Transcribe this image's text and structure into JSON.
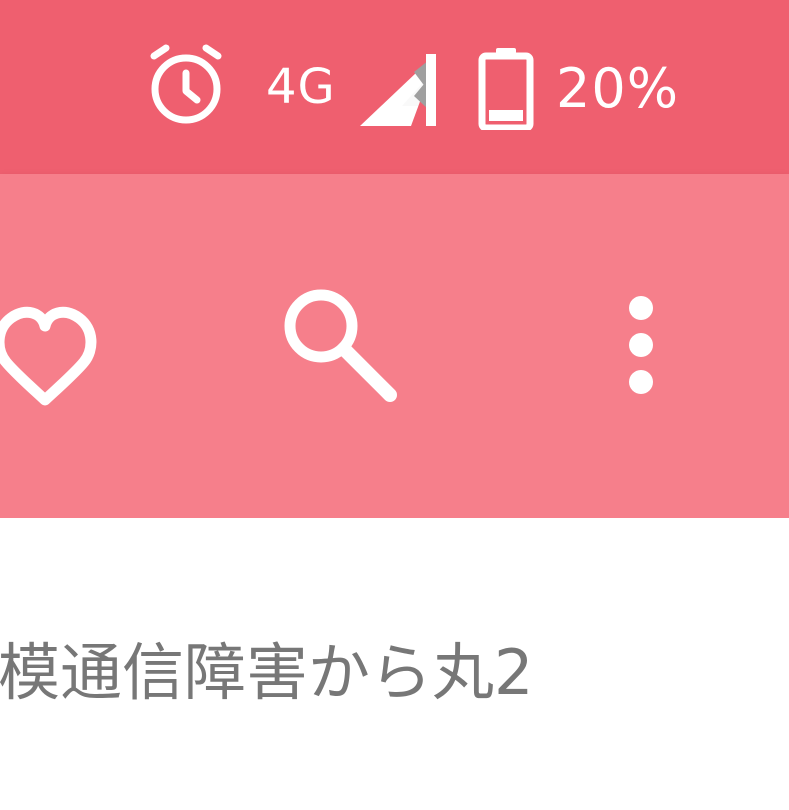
{
  "status_bar": {
    "background": "#ef5f6f",
    "alarm_icon": "alarm-clock-icon",
    "network": "4G",
    "signal_icon": "cellular-signal-icon",
    "battery_icon": "battery-icon",
    "battery_level": "20%"
  },
  "toolbar": {
    "background": "#f67f8b",
    "actions": {
      "favorite_icon": "heart-outline-icon",
      "search_icon": "search-icon",
      "more_icon": "more-vertical-icon"
    }
  },
  "content": {
    "title": "模通信障害から丸2"
  }
}
